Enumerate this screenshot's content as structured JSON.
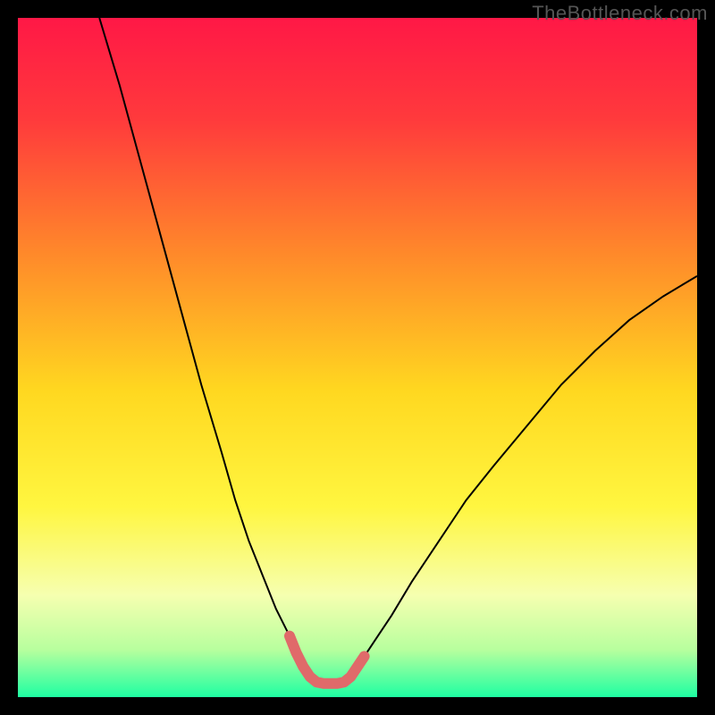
{
  "watermark": "TheBottleneck.com",
  "chart_data": {
    "type": "line",
    "title": "",
    "xlabel": "",
    "ylabel": "",
    "xlim": [
      0,
      100
    ],
    "ylim": [
      0,
      100
    ],
    "background_gradient": {
      "stops": [
        {
          "offset": 0.0,
          "color": "#ff1846"
        },
        {
          "offset": 0.15,
          "color": "#ff3a3c"
        },
        {
          "offset": 0.35,
          "color": "#ff8a2a"
        },
        {
          "offset": 0.55,
          "color": "#ffd820"
        },
        {
          "offset": 0.72,
          "color": "#fff640"
        },
        {
          "offset": 0.85,
          "color": "#f6ffb0"
        },
        {
          "offset": 0.93,
          "color": "#b8ff9e"
        },
        {
          "offset": 1.0,
          "color": "#1effa2"
        }
      ]
    },
    "series": [
      {
        "name": "bottleneck-curve",
        "type": "line",
        "color": "#000000",
        "stroke_width": 2,
        "x": [
          12,
          15,
          18,
          21,
          24,
          27,
          30,
          32,
          34,
          36,
          38,
          40,
          41,
          42,
          43,
          44,
          45,
          47,
          48,
          49,
          50,
          51,
          53,
          55,
          58,
          62,
          66,
          70,
          75,
          80,
          85,
          90,
          95,
          100
        ],
        "y": [
          100,
          90,
          79,
          68,
          57,
          46,
          36,
          29,
          23,
          18,
          13,
          9,
          6.5,
          4.5,
          3,
          2.2,
          2,
          2,
          2.2,
          3,
          4.5,
          6,
          9,
          12,
          17,
          23,
          29,
          34,
          40,
          46,
          51,
          55.5,
          59,
          62
        ]
      },
      {
        "name": "valley-highlight",
        "type": "line",
        "color": "#e06a6a",
        "stroke_width": 12,
        "linecap": "round",
        "x": [
          40,
          41,
          42,
          43,
          44,
          45,
          47,
          48,
          49,
          50,
          51
        ],
        "y": [
          9,
          6.5,
          4.5,
          3,
          2.2,
          2,
          2,
          2.2,
          3,
          4.5,
          6
        ]
      }
    ]
  }
}
